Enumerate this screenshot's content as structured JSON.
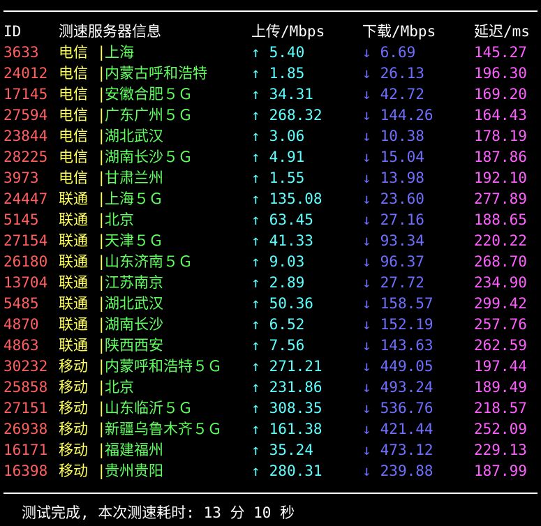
{
  "header": {
    "id": "ID",
    "name": "测速服务器信息",
    "upload": "上传/Mbps",
    "download": "下载/Mbps",
    "latency": "延迟/ms"
  },
  "separator": "|",
  "up_arrow": "↑",
  "down_arrow": "↓",
  "colors": {
    "id": "#ff5f5f",
    "isp": "#ffff5f",
    "city": "#5fff5f",
    "upload": "#5fffff",
    "download": "#6f6fff",
    "latency": "#ff5fff",
    "text": "#ffffff",
    "background": "#000000"
  },
  "rows": [
    {
      "id": "3633",
      "isp": "电信",
      "city": "上海",
      "up": "5.40",
      "down": "6.69",
      "latency": "145.27"
    },
    {
      "id": "24012",
      "isp": "电信",
      "city": "内蒙古呼和浩特",
      "up": "1.85",
      "down": "26.13",
      "latency": "196.30"
    },
    {
      "id": "17145",
      "isp": "电信",
      "city": "安徽合肥５Ｇ",
      "up": "34.31",
      "down": "42.72",
      "latency": "169.20"
    },
    {
      "id": "27594",
      "isp": "电信",
      "city": "广东广州５Ｇ",
      "up": "268.32",
      "down": "144.26",
      "latency": "164.43"
    },
    {
      "id": "23844",
      "isp": "电信",
      "city": "湖北武汉",
      "up": "3.06",
      "down": "10.38",
      "latency": "178.19"
    },
    {
      "id": "28225",
      "isp": "电信",
      "city": "湖南长沙５Ｇ",
      "up": "4.91",
      "down": "15.04",
      "latency": "187.86"
    },
    {
      "id": "3973",
      "isp": "电信",
      "city": "甘肃兰州",
      "up": "1.55",
      "down": "13.98",
      "latency": "192.10"
    },
    {
      "id": "24447",
      "isp": "联通",
      "city": "上海５Ｇ",
      "up": "135.08",
      "down": "23.60",
      "latency": "277.89"
    },
    {
      "id": "5145",
      "isp": "联通",
      "city": "北京",
      "up": "63.45",
      "down": "27.16",
      "latency": "188.65"
    },
    {
      "id": "27154",
      "isp": "联通",
      "city": "天津５Ｇ",
      "up": "41.33",
      "down": "93.34",
      "latency": "220.22"
    },
    {
      "id": "26180",
      "isp": "联通",
      "city": "山东济南５Ｇ",
      "up": "9.03",
      "down": "96.37",
      "latency": "268.70"
    },
    {
      "id": "13704",
      "isp": "联通",
      "city": "江苏南京",
      "up": "2.89",
      "down": "27.72",
      "latency": "234.90"
    },
    {
      "id": "5485",
      "isp": "联通",
      "city": "湖北武汉",
      "up": "50.36",
      "down": "158.57",
      "latency": "299.42"
    },
    {
      "id": "4870",
      "isp": "联通",
      "city": "湖南长沙",
      "up": "6.52",
      "down": "152.19",
      "latency": "257.76"
    },
    {
      "id": "4863",
      "isp": "联通",
      "city": "陕西西安",
      "up": "7.56",
      "down": "143.63",
      "latency": "262.59"
    },
    {
      "id": "30232",
      "isp": "移动",
      "city": "内蒙呼和浩特５Ｇ",
      "up": "271.21",
      "down": "449.05",
      "latency": "197.44"
    },
    {
      "id": "25858",
      "isp": "移动",
      "city": "北京",
      "up": "231.86",
      "down": "493.24",
      "latency": "189.49"
    },
    {
      "id": "27151",
      "isp": "移动",
      "city": "山东临沂５Ｇ",
      "up": "308.35",
      "down": "536.76",
      "latency": "218.57"
    },
    {
      "id": "26938",
      "isp": "移动",
      "city": "新疆乌鲁木齐５Ｇ",
      "up": "161.38",
      "down": "421.44",
      "latency": "252.09"
    },
    {
      "id": "16171",
      "isp": "移动",
      "city": "福建福州",
      "up": "35.24",
      "down": "473.12",
      "latency": "229.13"
    },
    {
      "id": "16398",
      "isp": "移动",
      "city": "贵州贵阳",
      "up": "280.31",
      "down": "239.88",
      "latency": "187.99"
    }
  ],
  "footer": "测试完成, 本次测速耗时: 13 分 10 秒"
}
